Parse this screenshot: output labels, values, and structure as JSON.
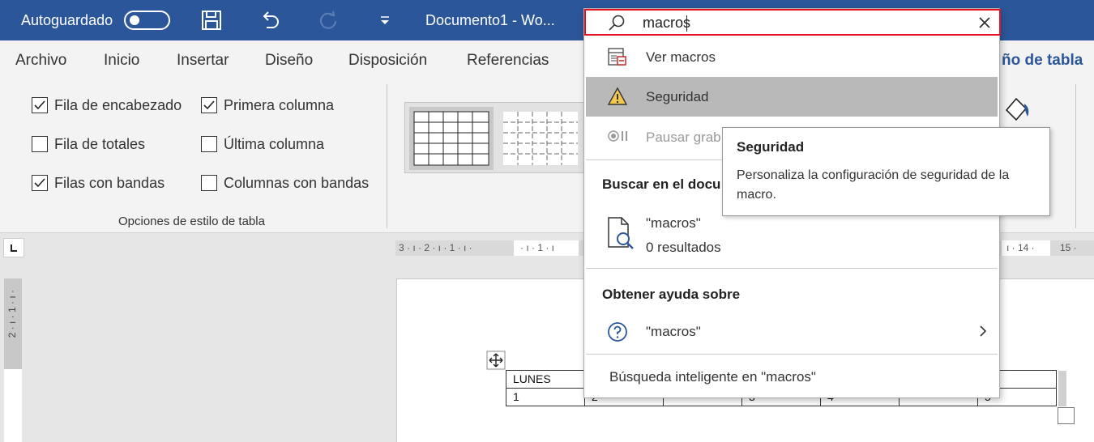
{
  "titlebar": {
    "autosave_label": "Autoguardado",
    "doc_title": "Documento1  -  Wo..."
  },
  "menu": {
    "items": [
      "Archivo",
      "Inicio",
      "Insertar",
      "Diseño",
      "Disposición",
      "Referencias"
    ],
    "contextual_tab": "ño de tabla"
  },
  "ribbon": {
    "options": [
      {
        "label": "Fila de encabezado",
        "checked": true
      },
      {
        "label": "Primera columna",
        "checked": true
      },
      {
        "label": "Fila de totales",
        "checked": false
      },
      {
        "label": "Última columna",
        "checked": false
      },
      {
        "label": "Filas con bandas",
        "checked": true
      },
      {
        "label": "Columnas con bandas",
        "checked": false
      }
    ],
    "group_label": "Opciones de estilo de tabla"
  },
  "ruler": {
    "left_marks": "3 · ı · 2 · ı · 1 · ı ·",
    "mid_marks": "· ı · 1 · ı",
    "right_marks": "ı · 14 ·",
    "right_end": "15 ·"
  },
  "vruler": {
    "marks": "2 · ı · 1 · ı ·"
  },
  "table": {
    "rows": [
      [
        "LUNES",
        "",
        "",
        "",
        "",
        "",
        ""
      ],
      [
        "1",
        "2",
        "",
        "3",
        "4",
        "",
        "5"
      ]
    ]
  },
  "search": {
    "query": "macros",
    "commands": [
      {
        "label": "Ver macros",
        "icon": "macro-list-icon",
        "highlighted": false,
        "disabled": false
      },
      {
        "label": "Seguridad",
        "icon": "warning-icon",
        "highlighted": true,
        "disabled": false
      },
      {
        "label": "Pausar grab",
        "icon": "pause-record-icon",
        "highlighted": false,
        "disabled": true
      }
    ],
    "doc_section_heading": "Buscar en el docu",
    "doc_result": {
      "query": "\"macros\"",
      "count": "0 resultados"
    },
    "help_heading": "Obtener ayuda sobre",
    "help_item": "\"macros\"",
    "smart_lookup": "Búsqueda inteligente en \"macros\""
  },
  "tooltip": {
    "title": "Seguridad",
    "body": "Personaliza la configuración de seguridad de la macro."
  },
  "colors": {
    "titlebar": "#2b579a",
    "accent": "#2b579a",
    "highlight": "#b9b9b9",
    "search_border": "#e81123"
  }
}
